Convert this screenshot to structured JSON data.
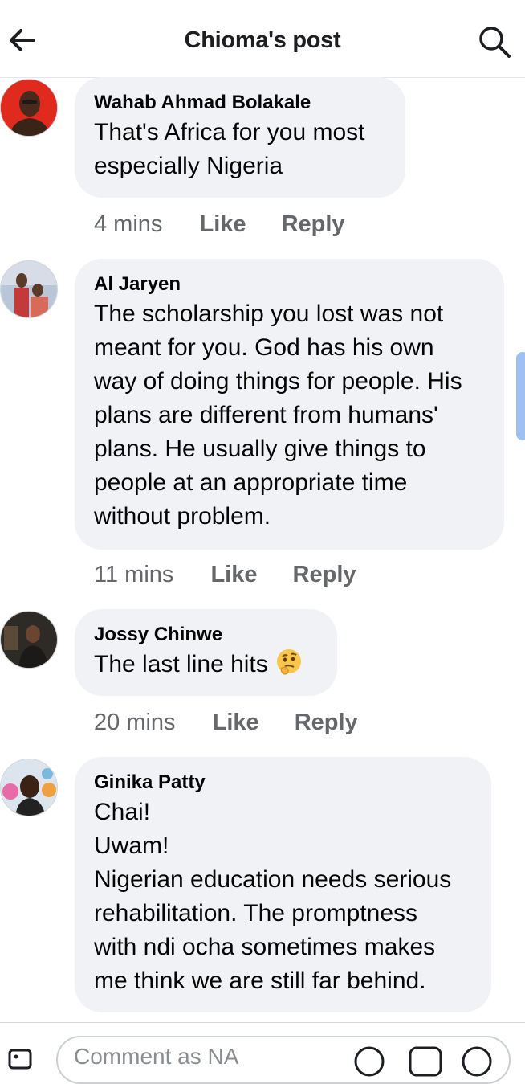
{
  "header": {
    "title": "Chioma's post",
    "back_icon": "arrow-left-icon",
    "search_icon": "search-icon"
  },
  "comments": [
    {
      "author": "Wahab Ahmad Bolakale",
      "text": "That's Africa for you most\nespecially Nigeria",
      "time": "4 mins",
      "like": "Like",
      "reply": "Reply"
    },
    {
      "author": "Al Jaryen",
      "text": "The scholarship you lost was not\nmeant for you. God has his own\nway of doing things for people. His\nplans are different from humans'\nplans. He usually give things to\npeople at an appropriate time\nwithout problem.",
      "time": "11 mins",
      "like": "Like",
      "reply": "Reply"
    },
    {
      "author": "Jossy Chinwe",
      "text": "The last line hits",
      "emoji": "thinking-face-emoji",
      "time": "20 mins",
      "like": "Like",
      "reply": "Reply"
    },
    {
      "author": "Ginika Patty",
      "text": "Chai!\nUwam!\nNigerian education needs serious\nrehabilitation. The promptness\nwith ndi ocha sometimes makes\nme think we are still far behind."
    }
  ],
  "composer": {
    "placeholder": "Comment as NA"
  },
  "colors": {
    "bubble": "#f0f2f5",
    "meta_text": "#65676b",
    "scrollbar": "#9ec1f2"
  }
}
